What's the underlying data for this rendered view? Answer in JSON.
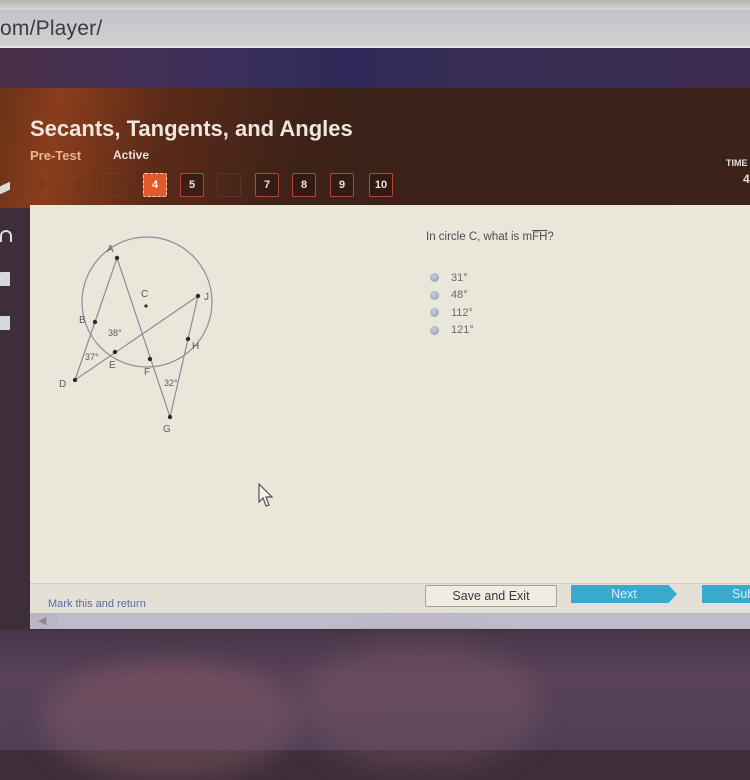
{
  "browser": {
    "address_text": "om/Player/"
  },
  "header": {
    "title": "Secants, Tangents, and Angles",
    "type": "Pre-Test",
    "status": "Active",
    "timer_label": "TIME",
    "timer_value": "4"
  },
  "question_nav": [
    {
      "label": "1",
      "state": "dim"
    },
    {
      "label": "2",
      "state": "dim"
    },
    {
      "label": "3",
      "state": "dim"
    },
    {
      "label": "4",
      "state": "current"
    },
    {
      "label": "5",
      "state": "available"
    },
    {
      "label": "6",
      "state": "dim"
    },
    {
      "label": "7",
      "state": "available"
    },
    {
      "label": "8",
      "state": "available"
    },
    {
      "label": "9",
      "state": "available"
    },
    {
      "label": "10",
      "state": "available"
    }
  ],
  "question": {
    "prefix": "In circle C, what is m",
    "arc": "FH",
    "suffix": "?",
    "options": [
      "31°",
      "48°",
      "112°",
      "121°"
    ]
  },
  "diagram": {
    "points": {
      "A": "A",
      "B": "B",
      "C": "C",
      "D": "D",
      "E": "E",
      "F": "F",
      "G": "G",
      "H": "H",
      "J": "J"
    },
    "angles": {
      "BEA": "38°",
      "D": "37°",
      "G": "32°"
    }
  },
  "footer": {
    "mark_label": "Mark this and return",
    "save_exit": "Save and Exit",
    "next": "Next",
    "submit": "Submit"
  },
  "colors": {
    "current_question": "#e35a2a",
    "nav_border": "#b0483a",
    "next_button": "#3aa9cd",
    "header_bg": "#3a2119"
  }
}
